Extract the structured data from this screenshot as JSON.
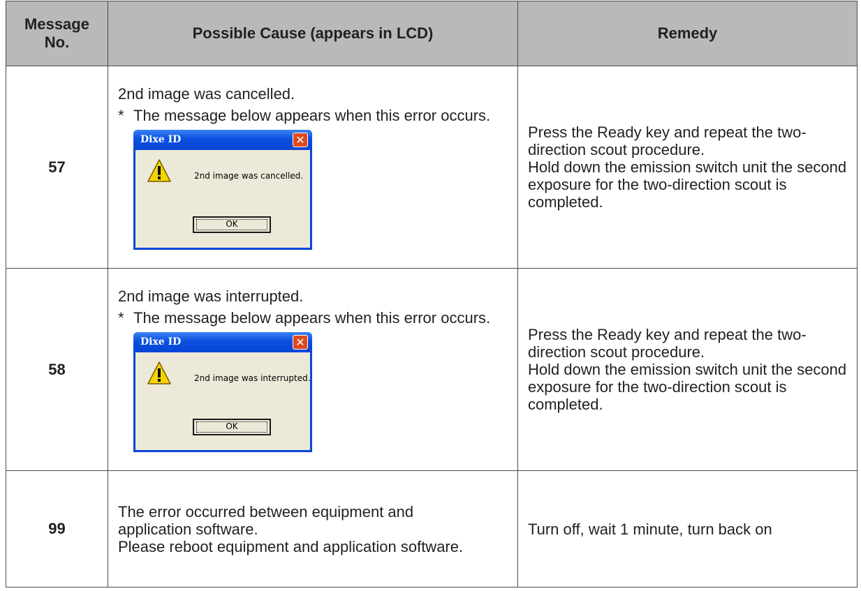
{
  "headers": {
    "message_no": "Message No.",
    "cause": "Possible Cause (appears in LCD)",
    "remedy": "Remedy"
  },
  "rows": [
    {
      "number": "57",
      "cause_lines": [
        "2nd image was cancelled."
      ],
      "note_star": "*",
      "note": "The message below appears when this error occurs.",
      "dialog": {
        "title": "Dixe ID",
        "close_glyph": "✕",
        "message": "2nd image was cancelled.",
        "ok_label": "OK"
      },
      "remedy": "Press the Ready key and repeat the two-direction scout procedure.\nHold down the emission switch unit the second exposure for the two-direction scout is completed."
    },
    {
      "number": "58",
      "cause_lines": [
        "2nd image was interrupted."
      ],
      "note_star": "*",
      "note": "The message below appears when this error occurs.",
      "dialog": {
        "title": "Dixe ID",
        "close_glyph": "✕",
        "message": "2nd image was interrupted.",
        "ok_label": "OK"
      },
      "remedy": "Press the Ready key and repeat the two-direction scout procedure.\nHold down the emission switch unit the second exposure for the two-direction scout is completed."
    },
    {
      "number": "99",
      "cause": "The error occurred between equipment and application software.\nPlease reboot equipment and application software.",
      "remedy": "Turn off, wait 1 minute, turn back on"
    }
  ],
  "colors": {
    "header_bg": "#b9b9b9",
    "border": "#4a4a4a",
    "dialog_frame": "#0a46d8",
    "dialog_body": "#ece9d8",
    "close_button": "#e0491f",
    "warning_yellow": "#f5d400"
  },
  "icons": {
    "warning": "warning-icon",
    "close": "close-icon"
  }
}
